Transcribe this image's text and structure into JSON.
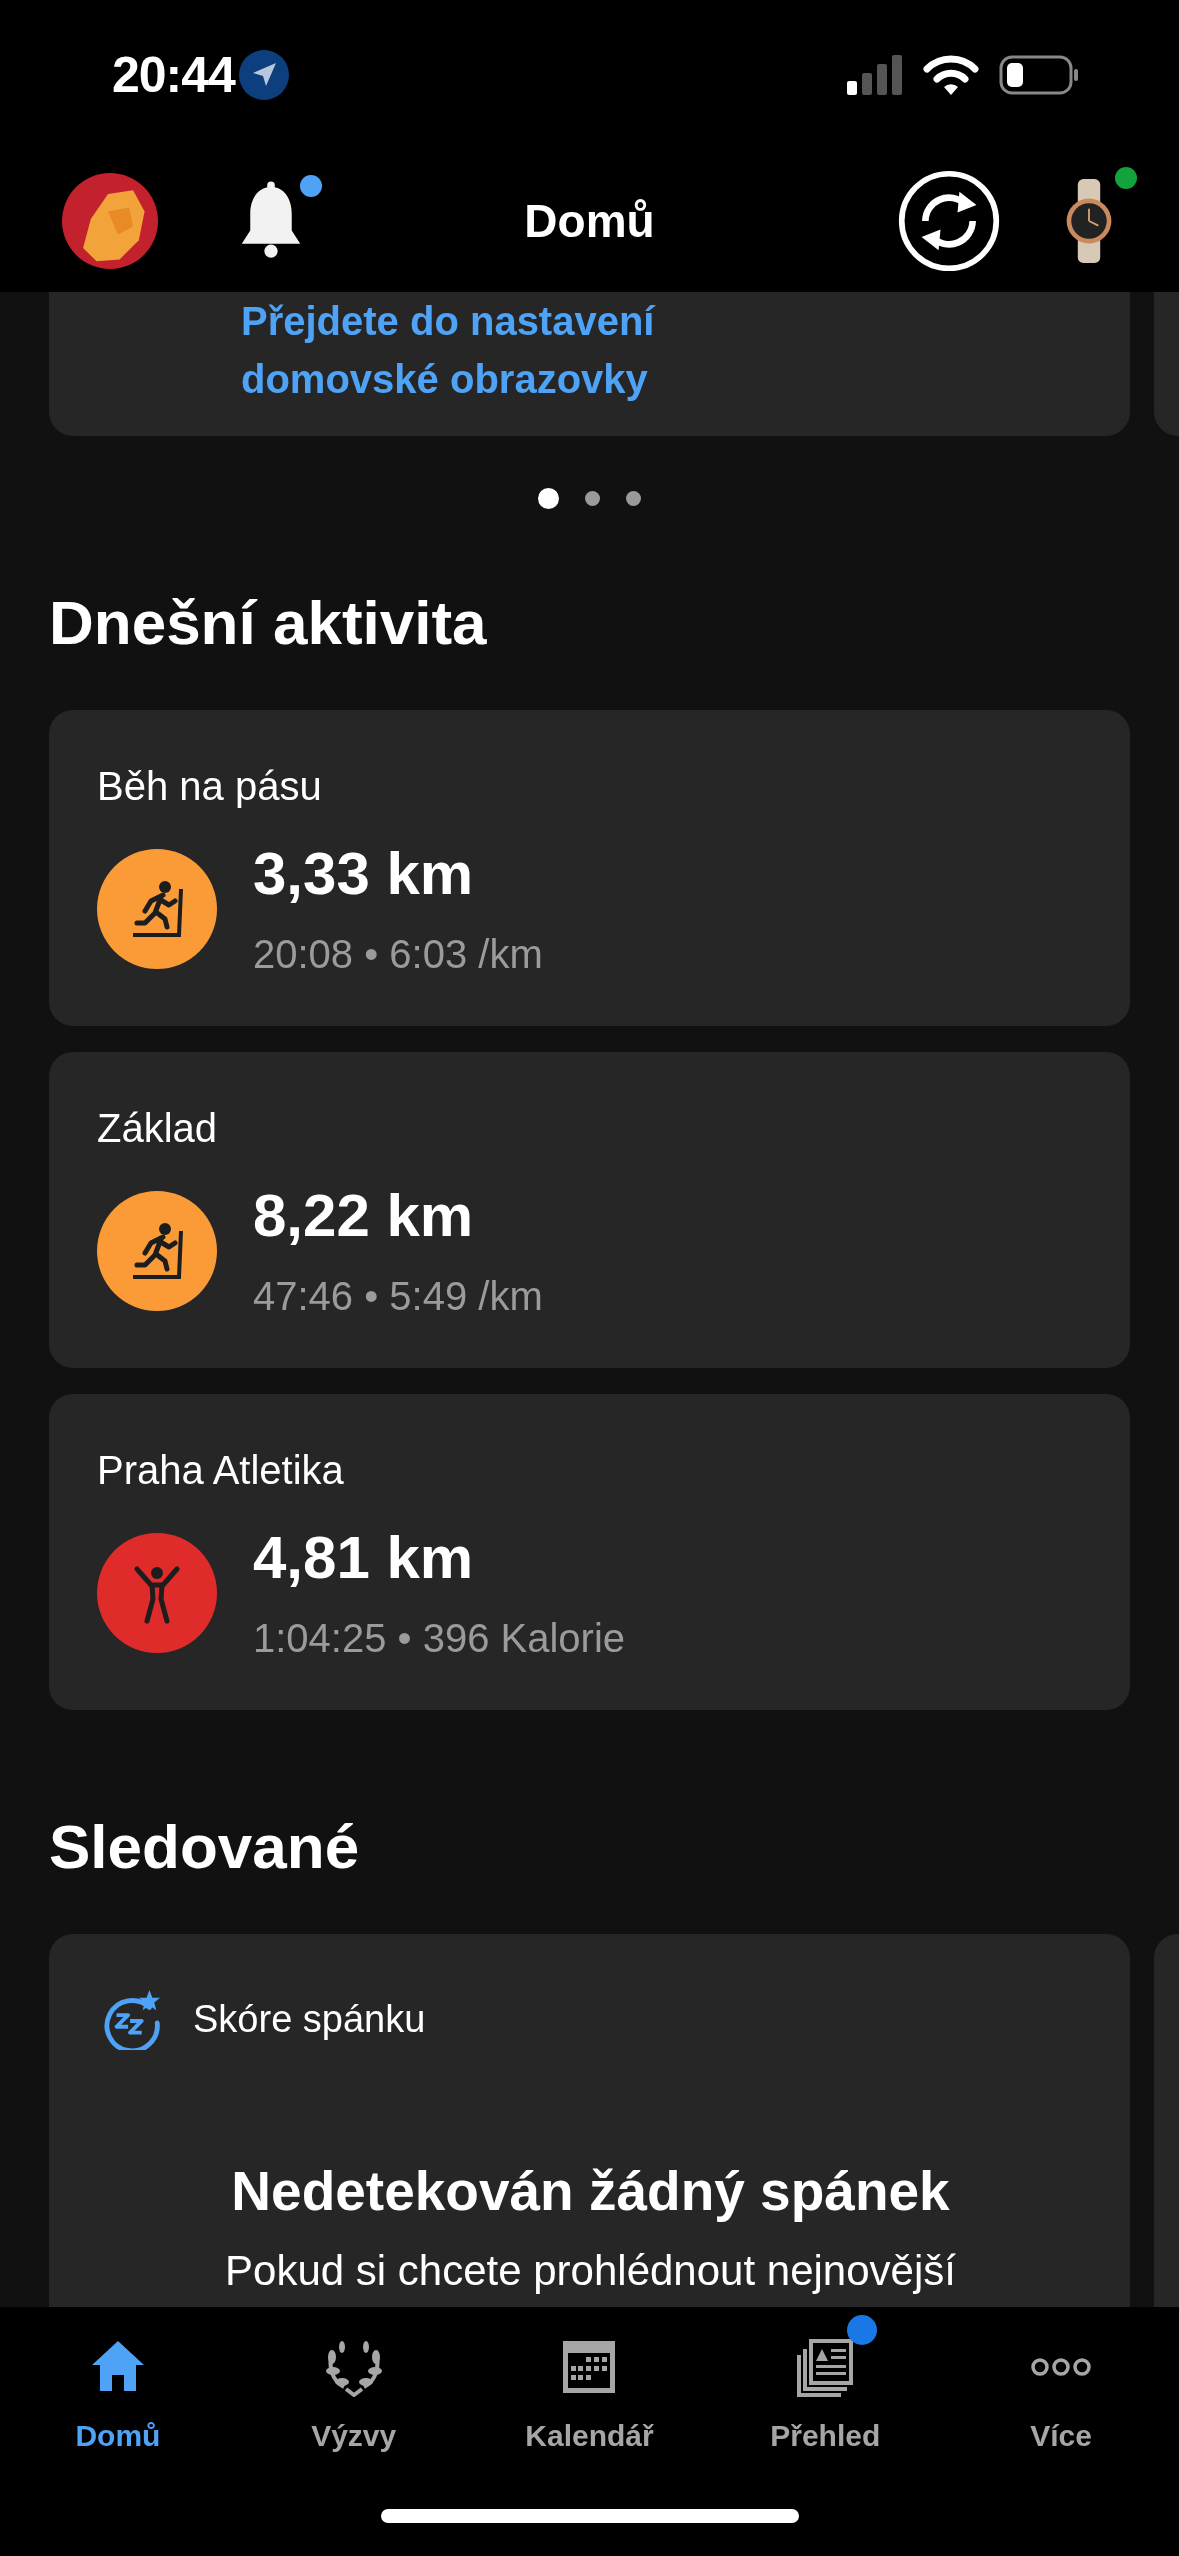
{
  "status_bar": {
    "time": "20:44"
  },
  "header": {
    "title": "Domů",
    "notification_badge": true,
    "device_connected": true
  },
  "promo_card": {
    "lines": [
      "Přejdete do nastavení",
      "domovské obrazovky"
    ]
  },
  "carousel": {
    "pages": [
      {
        "selected": true
      },
      {
        "selected": false
      },
      {
        "selected": false
      }
    ]
  },
  "today": {
    "heading": "Dnešní aktivita",
    "activities": [
      {
        "name": "Běh na pásu",
        "kind": "treadmill",
        "distance": "3,33 km",
        "summary": "20:08 • 6:03 /km"
      },
      {
        "name": "Základ",
        "kind": "treadmill",
        "distance": "8,22 km",
        "summary": "47:46 • 5:49 /km"
      },
      {
        "name": "Praha Atletika",
        "kind": "fitness",
        "distance": "4,81 km",
        "summary": "1:04:25 • 396 Kalorie"
      }
    ]
  },
  "followed": {
    "heading": "Sledované",
    "cards": [
      {
        "title": "Skóre spánku",
        "headline": "Nedetekován žádný spánek",
        "body": "Pokud si chcete prohlédnout nejnovější"
      }
    ]
  },
  "tab_bar": [
    {
      "label": "Domů",
      "kind": "home",
      "selected": true,
      "badge": false
    },
    {
      "label": "Výzvy",
      "kind": "challenges",
      "selected": false,
      "badge": false
    },
    {
      "label": "Kalendář",
      "kind": "calendar",
      "selected": false,
      "badge": false
    },
    {
      "label": "Přehled",
      "kind": "feed",
      "selected": false,
      "badge": true
    },
    {
      "label": "Více",
      "kind": "more",
      "selected": false,
      "badge": false
    }
  ]
}
